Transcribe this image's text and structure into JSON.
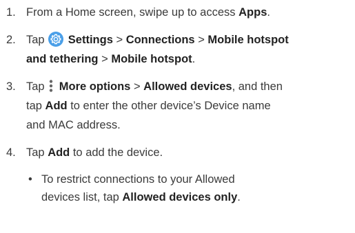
{
  "steps": [
    {
      "number": "1.",
      "t1": "From a Home screen, swipe up to access ",
      "b1": "Apps",
      "t2": "."
    },
    {
      "number": "2.",
      "t1": "Tap ",
      "icon": "settings-gear-icon",
      "b1": "Settings",
      "sep1": " > ",
      "b2": "Connections",
      "sep2": " > ",
      "b3": "Mobile hotspot",
      "b3b": "and tethering",
      "sep3": " > ",
      "b4": "Mobile hotspot",
      "end": "."
    },
    {
      "number": "3.",
      "t1": "Tap ",
      "icon": "more-options-icon",
      "b1": "More options",
      "sep1": " > ",
      "b2": "Allowed devices",
      "t2": ", and then",
      "t3": "tap ",
      "b3": "Add",
      "t4": " to enter the other device’s Device name",
      "t5": "and MAC address."
    },
    {
      "number": "4.",
      "t1": "Tap ",
      "b1": "Add",
      "t2": " to add the device."
    }
  ],
  "bullet": {
    "marker": "•",
    "line1": "To restrict connections to your Allowed",
    "line2a": "devices list, tap ",
    "b1": "Allowed devices only",
    "end": "."
  },
  "colors": {
    "text": "#3a3a3a",
    "settings_icon_bg": "#4a9fe8"
  }
}
